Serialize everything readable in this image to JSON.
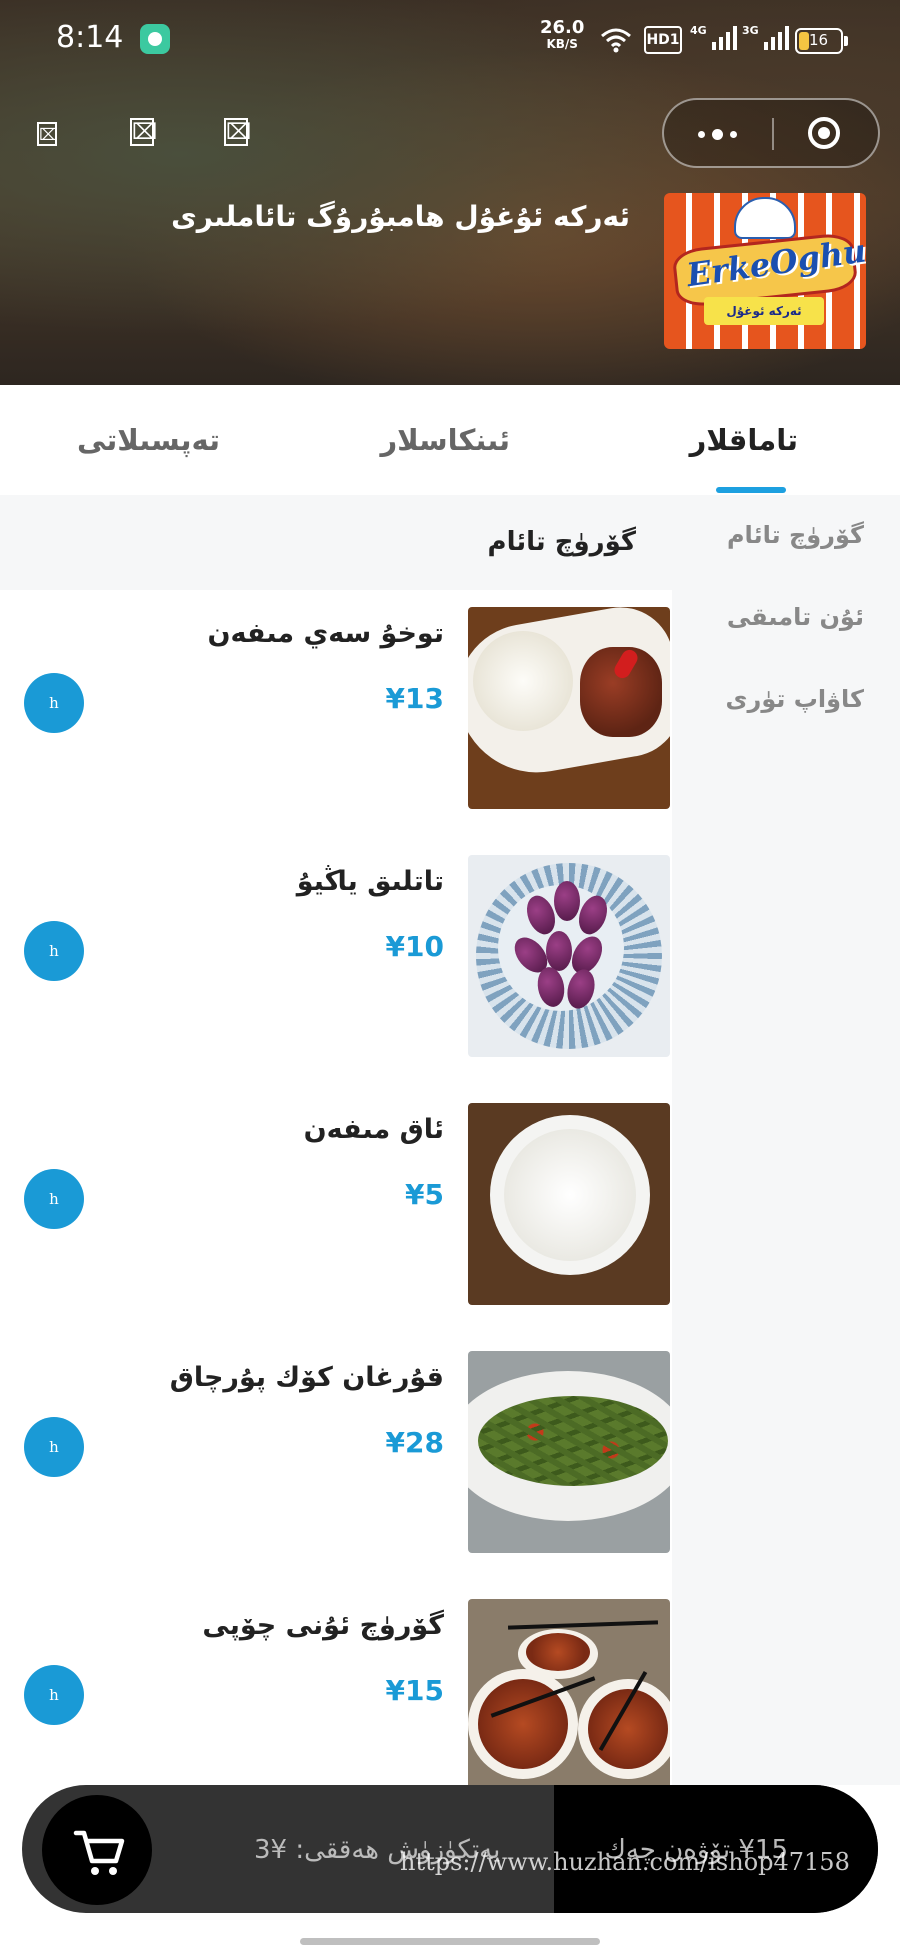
{
  "status_bar": {
    "time": "8:14",
    "net_speed": "26.0",
    "net_speed_unit": "KB/S",
    "hd_label": "HD1",
    "sig1_label": "4G",
    "sig2_label": "3G",
    "battery": "16"
  },
  "nav": {
    "btn1": "⌧",
    "btn2": "⌧",
    "btn3": "⌧"
  },
  "shop": {
    "name": "ئەركە ئۇغۇل هامبۇرۇگ تائاملىرى",
    "logo_text": "ErkeOghul",
    "logo_sub": "ئەركە ئوغۇل"
  },
  "tabs": [
    {
      "label": "تاماقلار",
      "active": true
    },
    {
      "label": "ئىنكاسلار",
      "active": false
    },
    {
      "label": "تەپسىلاتى",
      "active": false
    }
  ],
  "categories": [
    "گۆرۈچ تائام",
    "ئۇن تامىقى",
    "كاۋاپ تۈرى"
  ],
  "active_category_title": "گۆرۈچ تائام",
  "products": [
    {
      "name": "توخۇ سەي مىفەن",
      "price": "¥13",
      "add_label": "h"
    },
    {
      "name": "تاتلىق ياڭيۇ",
      "price": "¥10",
      "add_label": "h"
    },
    {
      "name": "ئاق مىفەن",
      "price": "¥5",
      "add_label": "h"
    },
    {
      "name": "قۇرغان كۆك پۇرچاق",
      "price": "¥28",
      "add_label": "h"
    },
    {
      "name": "گۆرۈچ ئۇنى چۆپى",
      "price": "¥15",
      "add_label": "h"
    }
  ],
  "cart": {
    "delivery_text": "يەتكۈزۈش ھەققى: ¥3",
    "checkout_text": "¥15 تۆۋەن چەك",
    "watermark": "https://www.huzhan.com/ishop47158"
  },
  "colors": {
    "accent": "#1a9ad6",
    "tab_underline": "#1da0e0",
    "cart_bg": "#333333"
  }
}
